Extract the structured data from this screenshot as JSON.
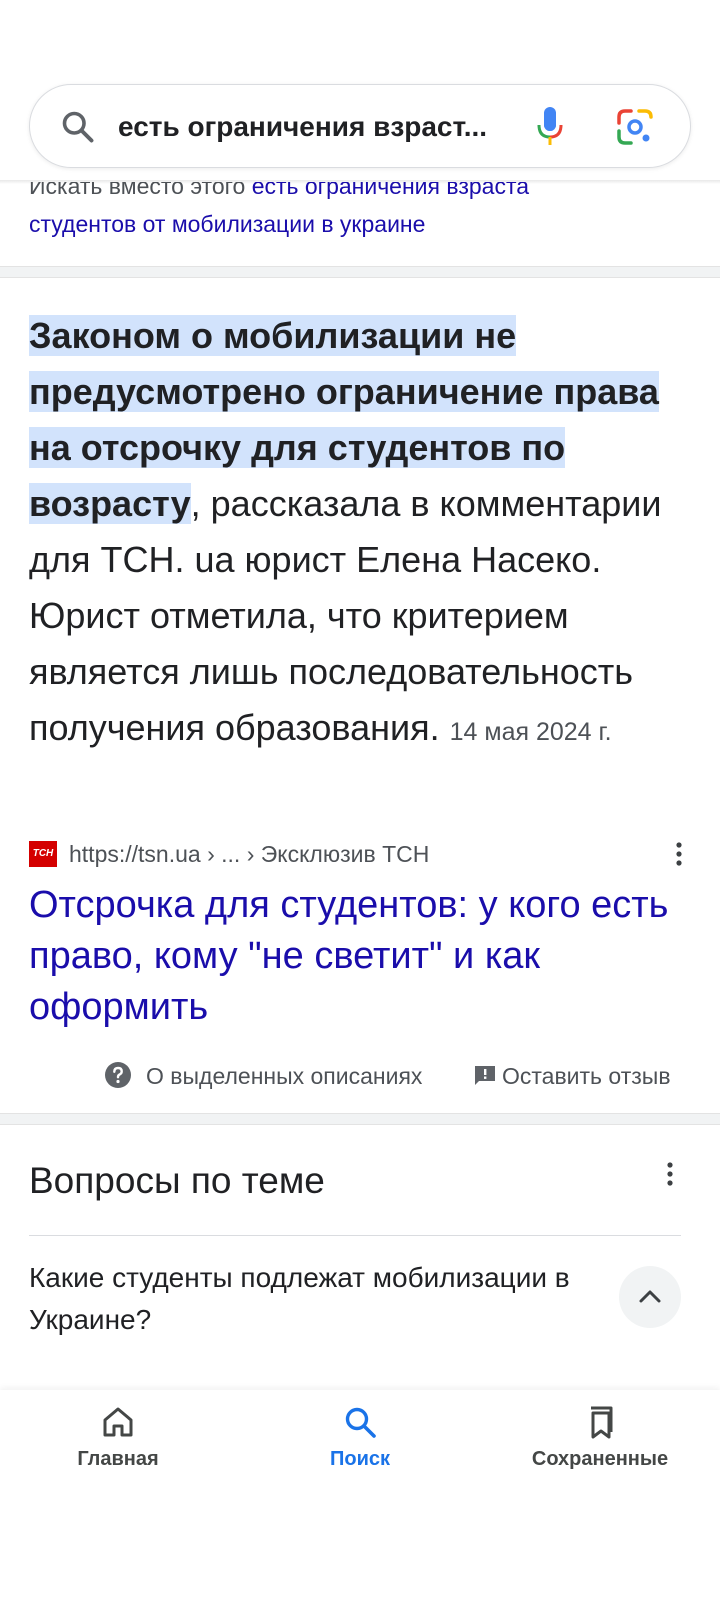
{
  "search": {
    "query": "есть ограничения взраст..."
  },
  "did_you_mean": {
    "prefix": "Искать вместо этого ",
    "suggestion_line1": "есть ограничения взраста",
    "suggestion_line2": "студентов от мобилизации в украине"
  },
  "snippet": {
    "highlight": "Законом о мобилизации не предусмотрено ограничение права на отсрочку для студентов по возрасту",
    "body": ", рассказала в комментарии для ТСН. ua юрист Елена Насеко. Юрист отметила, что критерием является лишь последовательность получения образования.",
    "date": "14 мая 2024 г."
  },
  "source": {
    "logo_text": "ТСН",
    "url": "https://tsn.ua › ... › Эксклюзив ТСН",
    "title": "Отсрочка для студентов: у кого есть право, кому \"не светит\" и как оформить"
  },
  "snippet_footer": {
    "about": "О выделенных описаниях",
    "feedback": "Оставить отзыв"
  },
  "related_questions": {
    "title": "Вопросы по теме",
    "items": [
      {
        "question": "Какие студенты подлежат мобилизации в Украине?"
      }
    ]
  },
  "bottom_nav": {
    "items": [
      {
        "label": "Главная",
        "icon": "home-icon"
      },
      {
        "label": "Поиск",
        "icon": "search-icon",
        "active": true
      },
      {
        "label": "Сохраненные",
        "icon": "bookmarks-icon"
      }
    ]
  },
  "colors": {
    "link": "#1a0dab",
    "highlight": "#d2e3fc",
    "active_nav": "#1a73e8",
    "tsn_red": "#d40000"
  }
}
